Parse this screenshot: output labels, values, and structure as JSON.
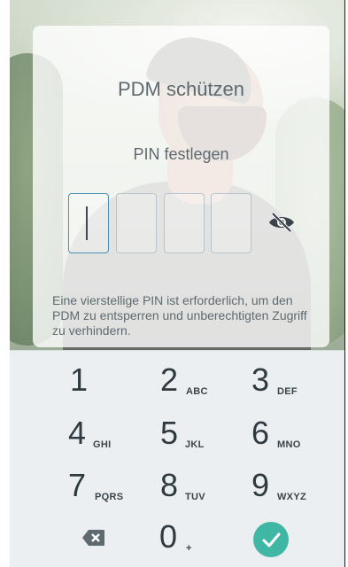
{
  "dialog": {
    "title": "PDM schützen",
    "subtitle": "PIN festlegen",
    "pin_digits": [
      "",
      "",
      "",
      ""
    ],
    "description": "Eine vierstellige PIN ist erforderlich, um den PDM zu entsperren und unberechtigten Zugriff zu verhindern.",
    "visibility_icon": "eye-off-icon"
  },
  "keypad": {
    "keys": [
      {
        "digit": "1",
        "letters": ""
      },
      {
        "digit": "2",
        "letters": "ABC"
      },
      {
        "digit": "3",
        "letters": "DEF"
      },
      {
        "digit": "4",
        "letters": "GHI"
      },
      {
        "digit": "5",
        "letters": "JKL"
      },
      {
        "digit": "6",
        "letters": "MNO"
      },
      {
        "digit": "7",
        "letters": "PQRS"
      },
      {
        "digit": "8",
        "letters": "TUV"
      },
      {
        "digit": "9",
        "letters": "WXYZ"
      },
      {
        "digit": "0",
        "letters": "+"
      }
    ],
    "backspace_icon": "backspace-icon",
    "confirm_icon": "check-icon",
    "confirm_color": "#40b7a4"
  },
  "colors": {
    "text": "#5e6a70",
    "keypad_bg": "#eceff1",
    "active_border": "#4a8fb4"
  }
}
